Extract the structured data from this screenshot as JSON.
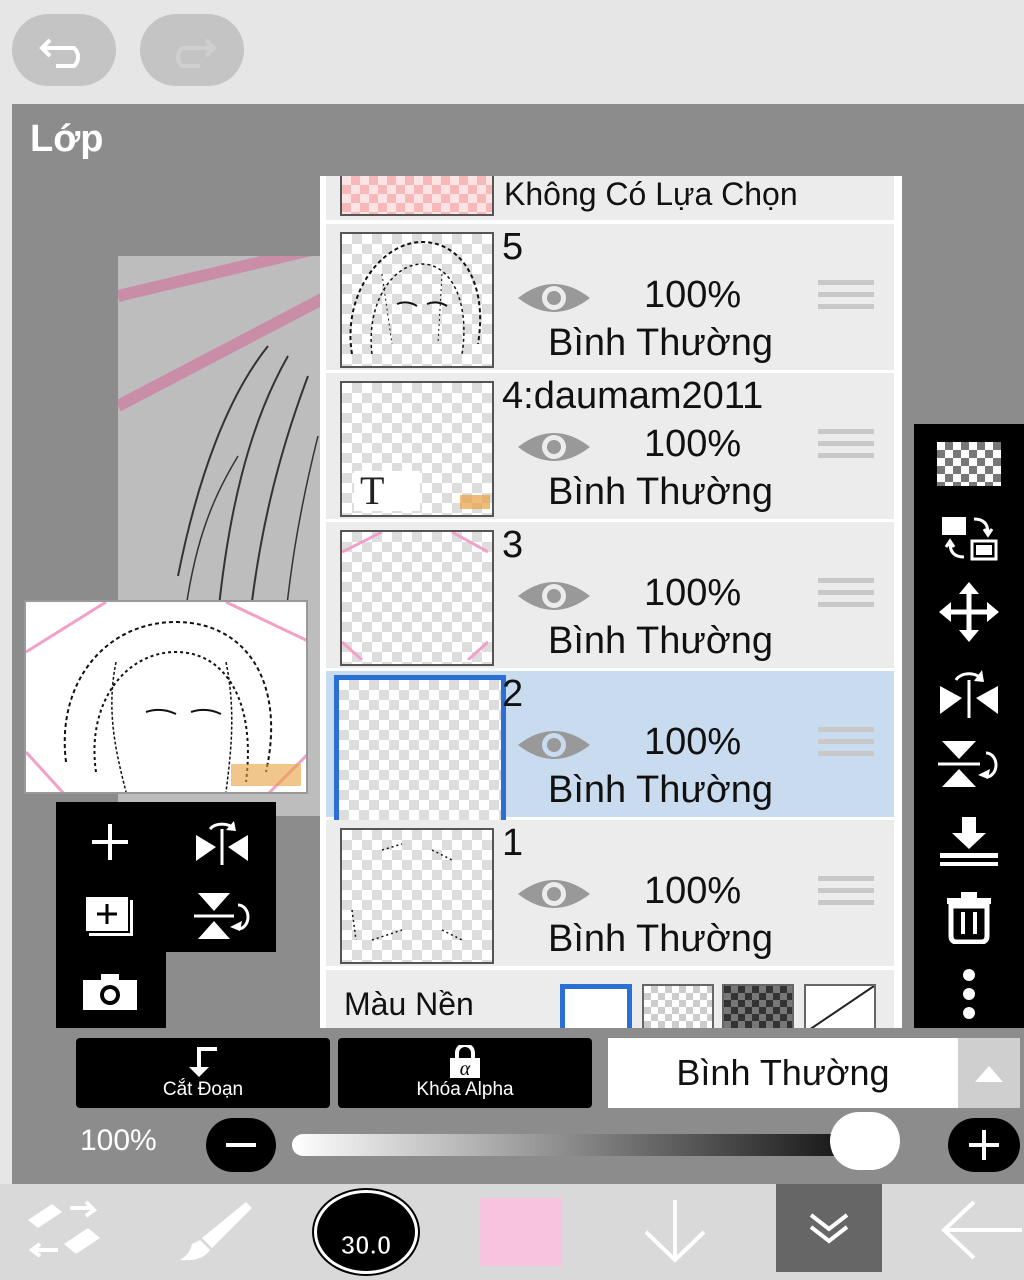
{
  "panel": {
    "title": "Lớp"
  },
  "selection_row": {
    "label": "Không Có Lựa Chọn"
  },
  "layers": [
    {
      "name": "5",
      "opacity": "100%",
      "blend": "Bình Thường",
      "selected": false
    },
    {
      "name": "4:daumam2011",
      "opacity": "100%",
      "blend": "Bình Thường",
      "selected": false
    },
    {
      "name": "3",
      "opacity": "100%",
      "blend": "Bình Thường",
      "selected": false
    },
    {
      "name": "2",
      "opacity": "100%",
      "blend": "Bình Thường",
      "selected": true
    },
    {
      "name": "1",
      "opacity": "100%",
      "blend": "Bình Thường",
      "selected": false
    }
  ],
  "background": {
    "label": "Màu Nền"
  },
  "actions": {
    "clip_label": "Cắt Đoạn",
    "alpha_lock_label": "Khóa Alpha"
  },
  "blend_mode": {
    "value": "Bình Thường"
  },
  "opacity": {
    "label": "100%",
    "value": 1.0
  },
  "brush": {
    "size": "30.0"
  },
  "colors": {
    "current": "#f7c3df",
    "accent": "#2a6fd6",
    "selected_row": "#c9dbee",
    "guide_line": "#e98fb8"
  },
  "icons": [
    "undo-icon",
    "redo-icon",
    "add-layer-icon",
    "flip-horizontal-icon",
    "add-layer-copy-icon",
    "flip-vertical-icon",
    "camera-icon",
    "transparency-icon",
    "layer-swap-icon",
    "move-icon",
    "flip-layer-horizontal-icon",
    "flip-layer-vertical-icon",
    "merge-down-icon",
    "trash-icon",
    "more-icon",
    "eye-icon",
    "drag-handle-icon",
    "clip-icon",
    "lock-icon",
    "brush-icon",
    "transform-icon",
    "arrow-down-icon",
    "chevron-down-icon",
    "back-arrow-icon"
  ]
}
